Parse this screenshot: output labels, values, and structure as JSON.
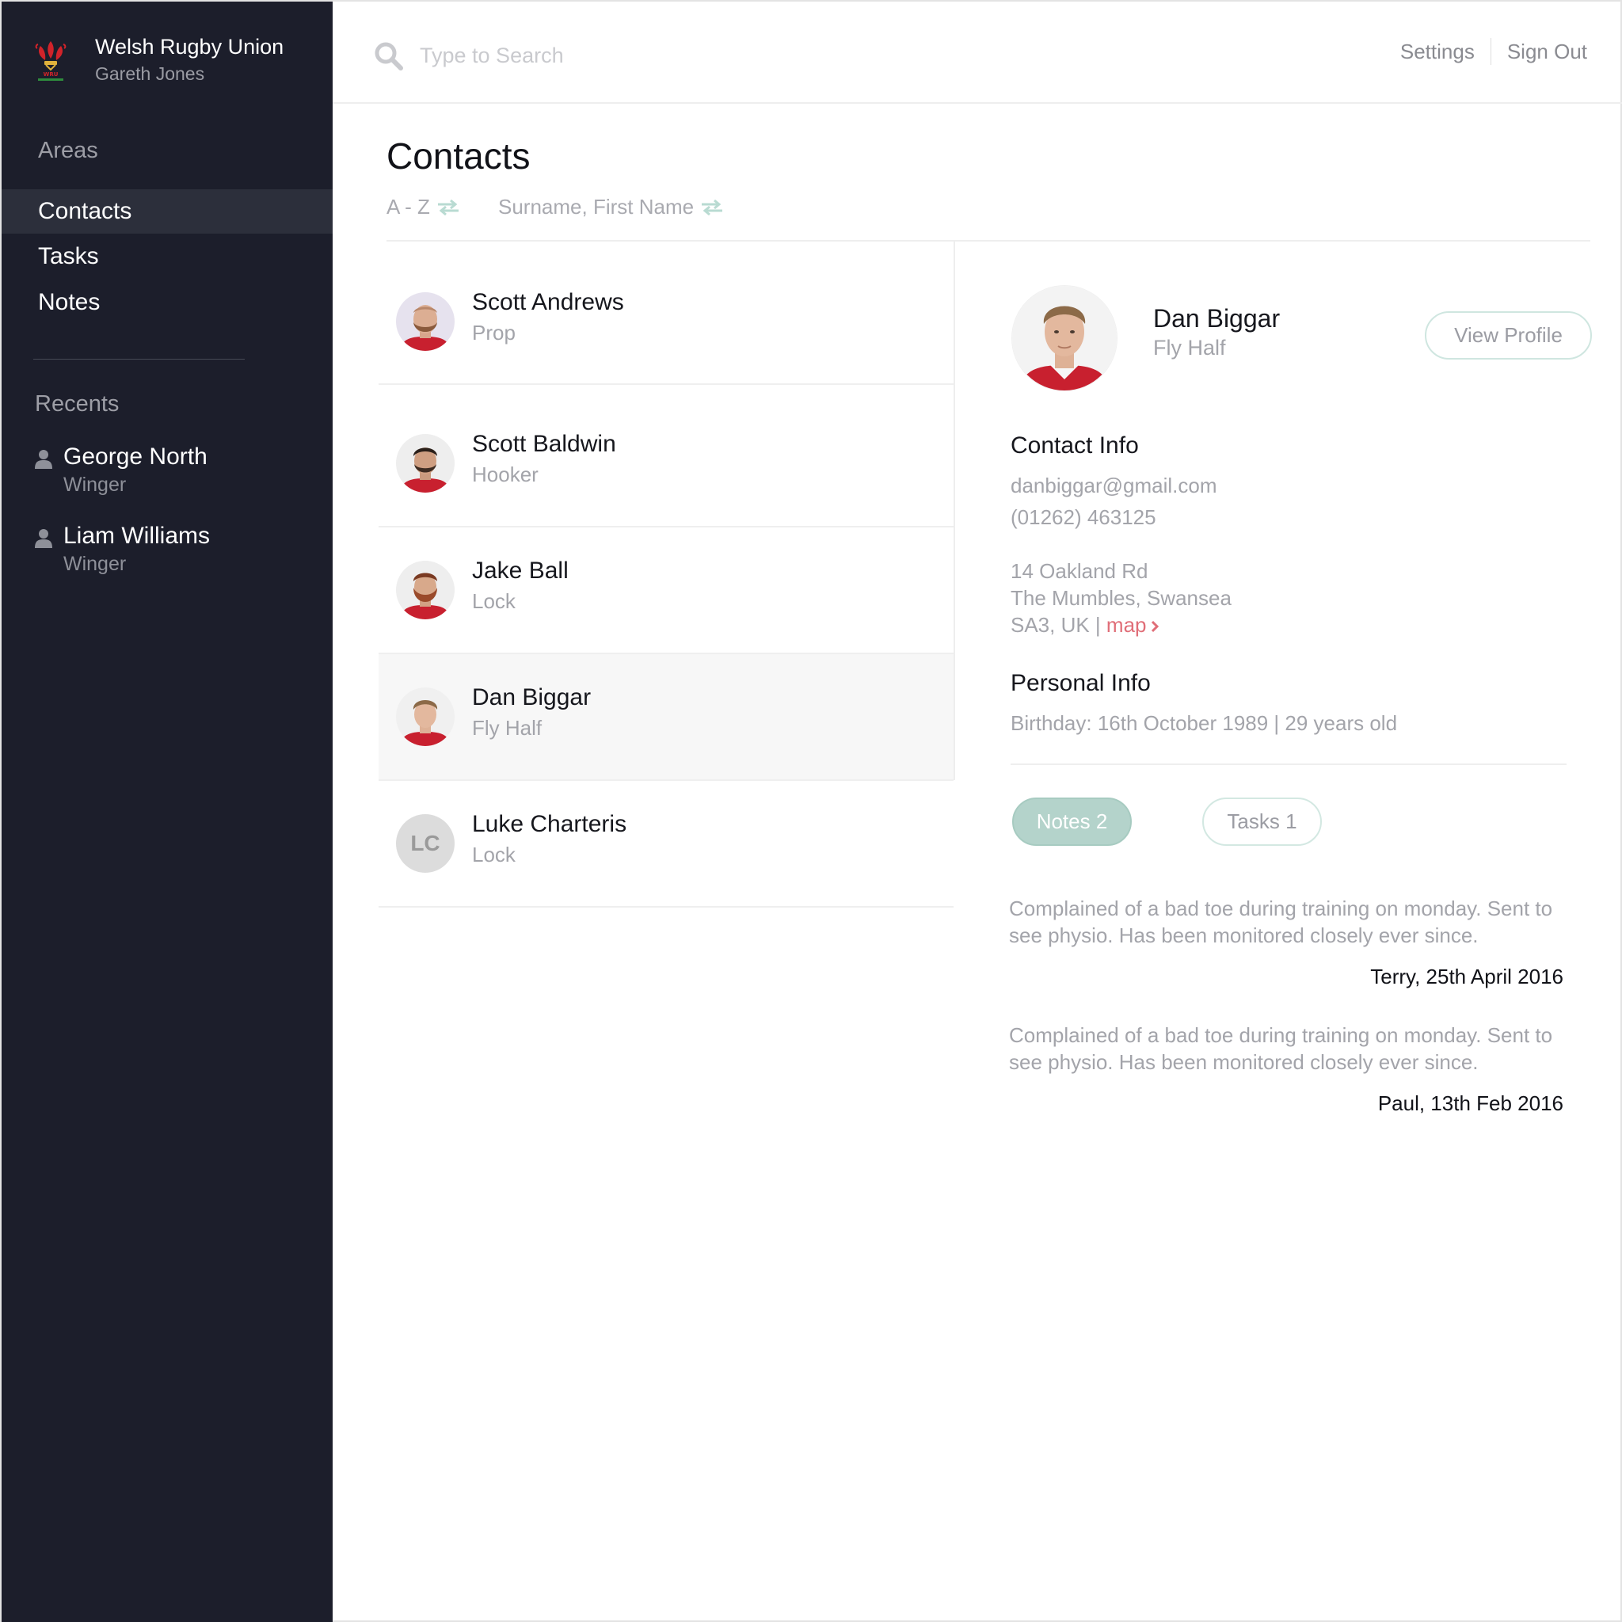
{
  "brand": {
    "title": "Welsh Rugby Union",
    "user": "Gareth Jones",
    "logo_icon": "wru-feathers-logo",
    "logo_colors": {
      "feathers": "#d1232a",
      "crown": "#e0b23c",
      "text": "#d1232a",
      "ribbon": "#2e8b3d"
    }
  },
  "sidebar": {
    "areas_label": "Areas",
    "items": [
      {
        "label": "Contacts",
        "active": true
      },
      {
        "label": "Tasks",
        "active": false
      },
      {
        "label": "Notes",
        "active": false
      }
    ],
    "recents_label": "Recents",
    "recents": [
      {
        "name": "George North",
        "role": "Winger",
        "icon": "user-icon"
      },
      {
        "name": "Liam Williams",
        "role": "Winger",
        "icon": "user-icon"
      }
    ]
  },
  "topbar": {
    "search_placeholder": "Type to Search",
    "search_value": "",
    "settings_label": "Settings",
    "signout_label": "Sign Out"
  },
  "page": {
    "title": "Contacts",
    "sort_order_label": "A - Z",
    "sort_field_label": "Surname, First Name",
    "sort_icon": "swap-arrows-icon"
  },
  "contacts": [
    {
      "name": "Scott Andrews",
      "role": "Prop",
      "avatar": "photo"
    },
    {
      "name": "Scott Baldwin",
      "role": "Hooker",
      "avatar": "photo"
    },
    {
      "name": "Jake Ball",
      "role": "Lock",
      "avatar": "photo"
    },
    {
      "name": "Dan Biggar",
      "role": "Fly Half",
      "avatar": "photo",
      "selected": true
    },
    {
      "name": "Luke Charteris",
      "role": "Lock",
      "avatar": "initials",
      "initials": "LC"
    }
  ],
  "detail": {
    "name": "Dan Biggar",
    "role": "Fly Half",
    "view_profile_label": "View Profile",
    "contact_heading": "Contact Info",
    "email": "danbiggar@gmail.com",
    "phone": "(01262) 463125",
    "address_line1": "14 Oakland Rd",
    "address_line2": "The Mumbles, Swansea",
    "address_line3": "SA3, UK |",
    "map_label": "map",
    "personal_heading": "Personal Info",
    "birthday": "Birthday: 16th October 1989 | 29 years old",
    "tabs": [
      {
        "label": "Notes 2",
        "active": true
      },
      {
        "label": "Tasks 1",
        "active": false
      }
    ],
    "notes": [
      {
        "text": "Complained of a bad toe during training on monday. Sent to see physio. Has been monitored closely ever since.",
        "meta": "Terry, 25th April 2016"
      },
      {
        "text": "Complained of a bad toe during training on monday. Sent to see physio. Has been monitored closely ever since.",
        "meta": "Paul, 13th Feb 2016"
      }
    ]
  },
  "colors": {
    "sidebar_bg": "#1c1e2b",
    "sidebar_active": "#2c2f3b",
    "accent_teal": "#b4d3cb",
    "link_red": "#e06e78",
    "jersey_red": "#c8202f"
  }
}
